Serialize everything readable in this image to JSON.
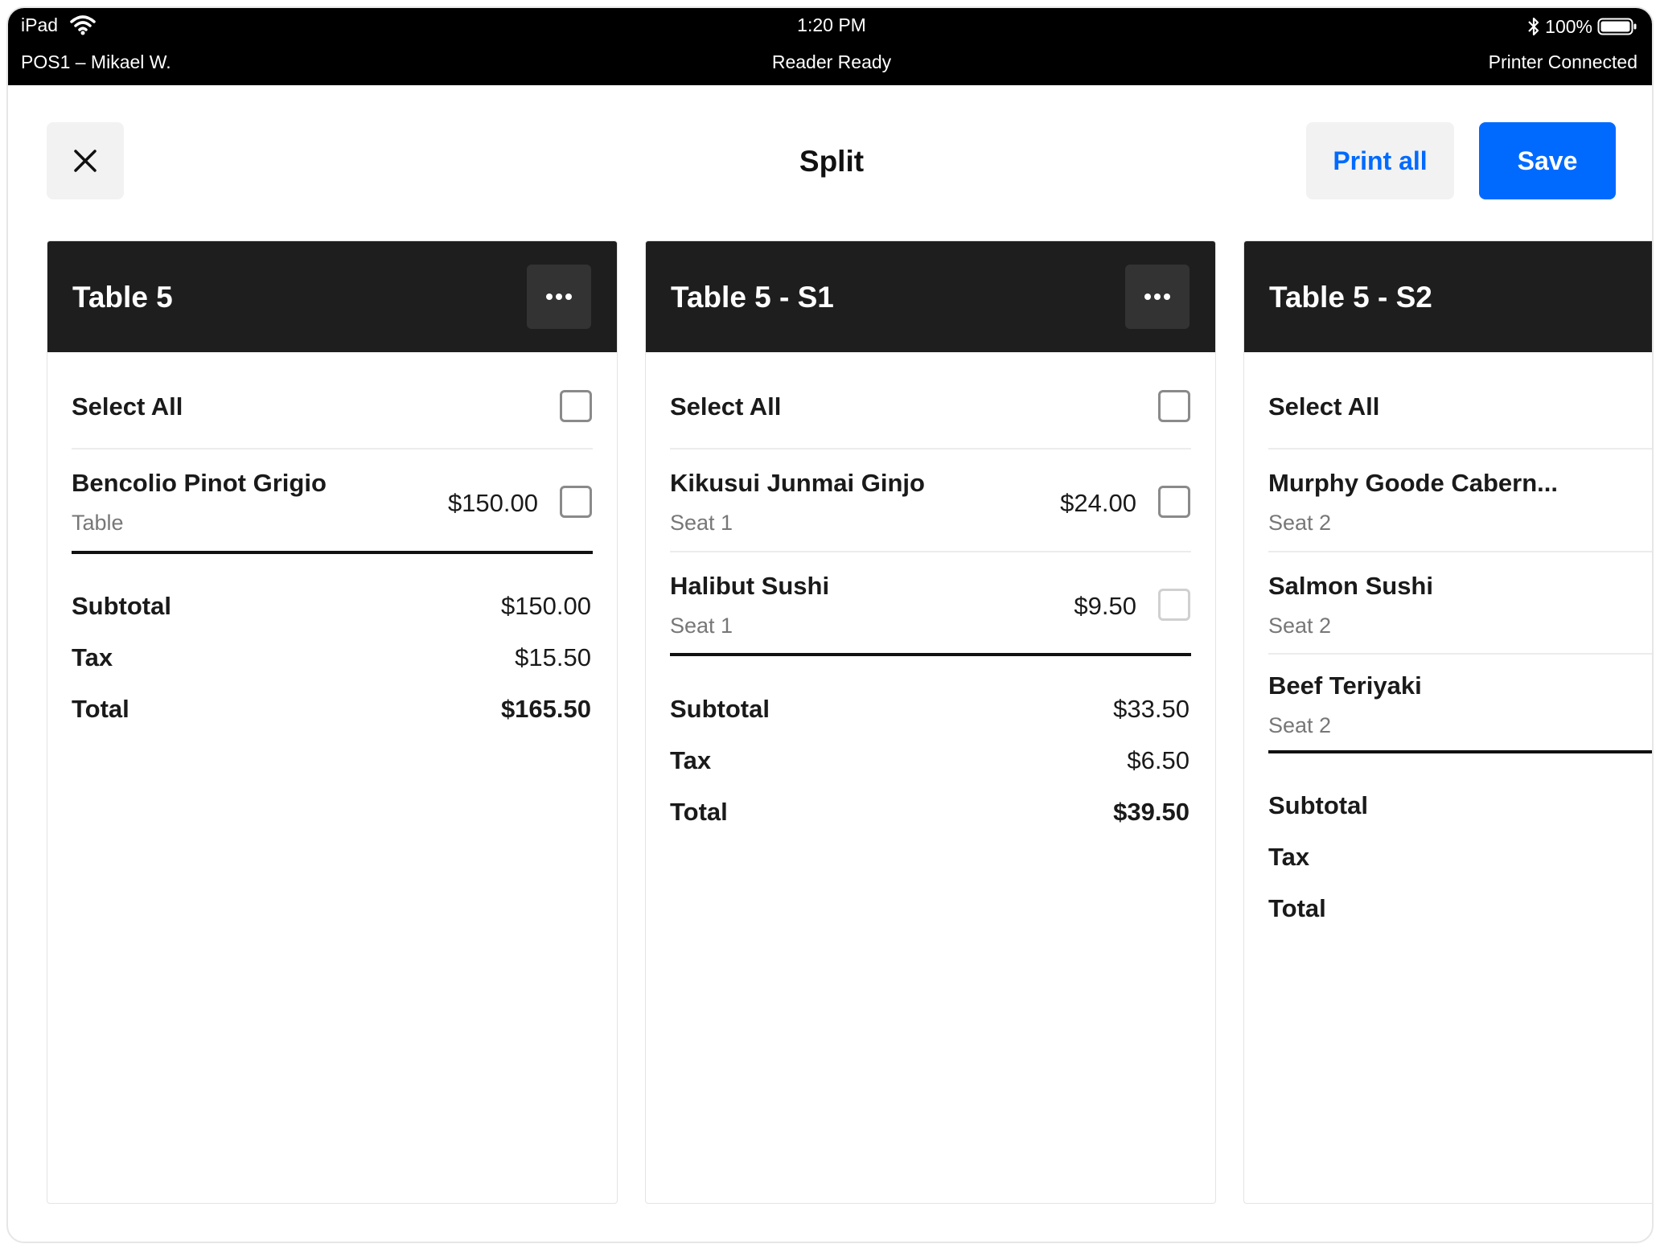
{
  "status_bar": {
    "device": "iPad",
    "time": "1:20 PM",
    "battery": "100%",
    "pos": "POS1 – Mikael W.",
    "reader": "Reader Ready",
    "printer": "Printer Connected"
  },
  "header": {
    "title": "Split",
    "print_all_label": "Print all",
    "save_label": "Save"
  },
  "colors": {
    "accent": "#006aff",
    "column_header": "#1e1e1e",
    "status_bar": "#000000"
  },
  "icons": {
    "close": "close-icon",
    "more": "more-icon",
    "wifi": "wifi-icon",
    "bluetooth": "bluetooth-icon",
    "battery": "battery-icon"
  },
  "checks": [
    {
      "title": "Table 5",
      "select_all_label": "Select All",
      "items": [
        {
          "name": "Bencolio Pinot Grigio",
          "sub": "Table",
          "price": "$150.00"
        }
      ],
      "subtotal_label": "Subtotal",
      "subtotal": "$150.00",
      "tax_label": "Tax",
      "tax": "$15.50",
      "total_label": "Total",
      "total": "$165.50"
    },
    {
      "title": "Table 5 - S1",
      "select_all_label": "Select All",
      "items": [
        {
          "name": "Kikusui Junmai Ginjo",
          "sub": "Seat 1",
          "price": "$24.00"
        },
        {
          "name": "Halibut Sushi",
          "sub": "Seat 1",
          "price": "$9.50"
        }
      ],
      "subtotal_label": "Subtotal",
      "subtotal": "$33.50",
      "tax_label": "Tax",
      "tax": "$6.50",
      "total_label": "Total",
      "total": "$39.50"
    },
    {
      "title": "Table 5 - S2",
      "select_all_label": "Select All",
      "items": [
        {
          "name": "Murphy Goode Cabern...",
          "sub": "Seat 2"
        },
        {
          "name": "Salmon Sushi",
          "sub": "Seat 2"
        },
        {
          "name": "Beef Teriyaki",
          "sub": "Seat  2"
        }
      ],
      "subtotal_label": "Subtotal",
      "tax_label": "Tax",
      "total_label": "Total"
    }
  ]
}
